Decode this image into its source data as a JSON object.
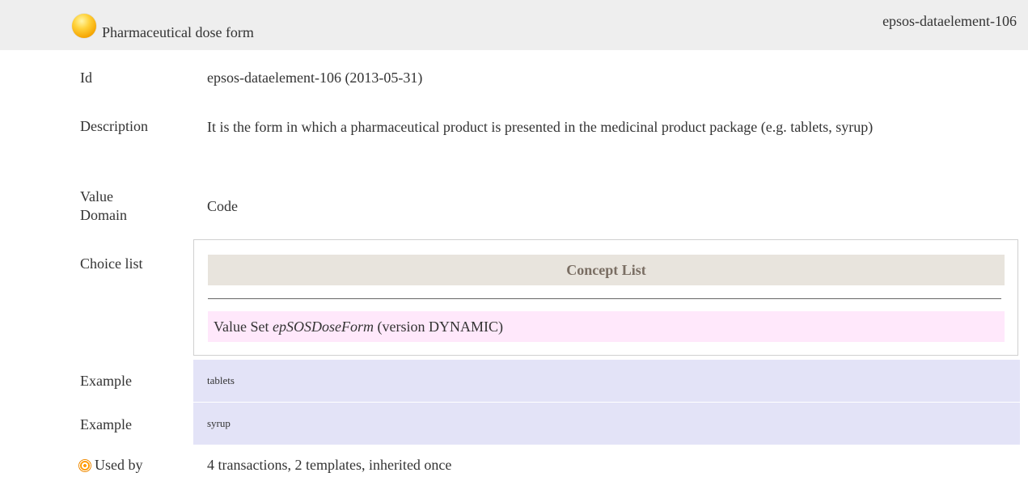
{
  "header": {
    "title": "Pharmaceutical dose form",
    "id": "epsos-dataelement-106",
    "status_icon": "status-circle-icon",
    "status_color": "#f5b400"
  },
  "rows": {
    "id": {
      "label": "Id",
      "value": "epsos-dataelement-106 (2013-05-31)"
    },
    "description": {
      "label": "Description",
      "value": "It is the form in which a pharmaceutical product is presented in the medicinal product package (e.g. tablets, syrup)"
    },
    "value_domain": {
      "label_line1": "Value",
      "label_line2": "Domain",
      "value": "Code"
    },
    "choice_list": {
      "label": "Choice list",
      "concept_list_title": "Concept List",
      "value_set_prefix": "Value Set",
      "value_set_name": "epSOSDoseForm",
      "value_set_suffix": "(version DYNAMIC)"
    },
    "examples": [
      {
        "label": "Example",
        "value": "tablets"
      },
      {
        "label": "Example",
        "value": "syrup"
      }
    ],
    "used_by": {
      "label": "Used by",
      "value": "4 transactions, 2 templates, inherited once",
      "icon": "target-icon"
    }
  },
  "colors": {
    "header_bg": "#eeeeee",
    "concept_head_bg": "#e8e4dd",
    "value_set_bg": "#ffe8fb",
    "example_bg": "#e3e3f7"
  }
}
